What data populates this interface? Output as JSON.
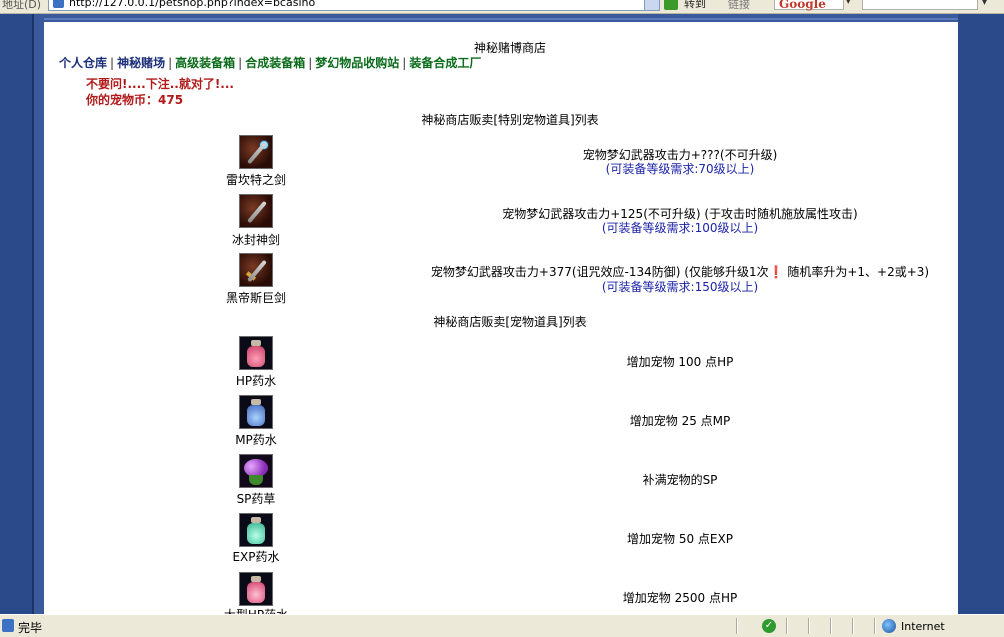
{
  "browser": {
    "address_label": "地址(D)",
    "url": "http://127.0.0.1/petshop.php?index=bcasino",
    "go_label": "转到",
    "links_label": "链接",
    "search_brand": "Google"
  },
  "page": {
    "title": "神秘赌博商店",
    "nav": [
      {
        "label": "个人仓库",
        "color": "#1c2f7a"
      },
      {
        "label": "神秘赌场",
        "color": "#1c2f7a"
      },
      {
        "label": "高级装备箱",
        "color": "#0b6b1b"
      },
      {
        "label": "合成装备箱",
        "color": "#0b6b1b"
      },
      {
        "label": "梦幻物品收购站",
        "color": "#0b6b1b"
      },
      {
        "label": "装备合成工厂",
        "color": "#0b6b1b"
      }
    ],
    "nav_separator": "|",
    "message": "不要问!....下注..就对了!...",
    "coins_label": "你的宠物币：475"
  },
  "special_section": {
    "title": "神秘商店贩卖[特别宠物道具]列表",
    "items": [
      {
        "name": "雷坎特之剑",
        "icon": "staff-sword-icon",
        "effect": "宠物梦幻武器攻击力+???(不可升级)",
        "requirement": "(可装备等级需求:70级以上)"
      },
      {
        "name": "冰封神剑",
        "icon": "ice-sword-icon",
        "effect": "宠物梦幻武器攻击力+125(不可升级) (于攻击时随机施放属性攻击)",
        "requirement": "(可装备等级需求:100级以上)"
      },
      {
        "name": "黑帝斯巨剑",
        "icon": "hades-greatsword-icon",
        "effect": "宠物梦幻武器攻击力+377(诅咒效应-134防御) (仅能够升级1次❗ 随机率升为+1、+2或+3)",
        "requirement": "(可装备等级需求:150级以上)"
      }
    ]
  },
  "pet_section": {
    "title": "神秘商店贩卖[宠物道具]列表",
    "items": [
      {
        "name": "HP药水",
        "icon": "hp-potion-icon",
        "effect": "增加宠物 100 点HP"
      },
      {
        "name": "MP药水",
        "icon": "mp-potion-icon",
        "effect": "增加宠物 25 点MP"
      },
      {
        "name": "SP药草",
        "icon": "sp-herb-icon",
        "effect": "补满宠物的SP"
      },
      {
        "name": "EXP药水",
        "icon": "exp-potion-icon",
        "effect": "增加宠物 50 点EXP"
      },
      {
        "name": "大型HP药水",
        "icon": "large-hp-potion-icon",
        "effect": "增加宠物 2500 点HP"
      }
    ]
  },
  "statusbar": {
    "status": "完毕",
    "zone": "Internet"
  }
}
